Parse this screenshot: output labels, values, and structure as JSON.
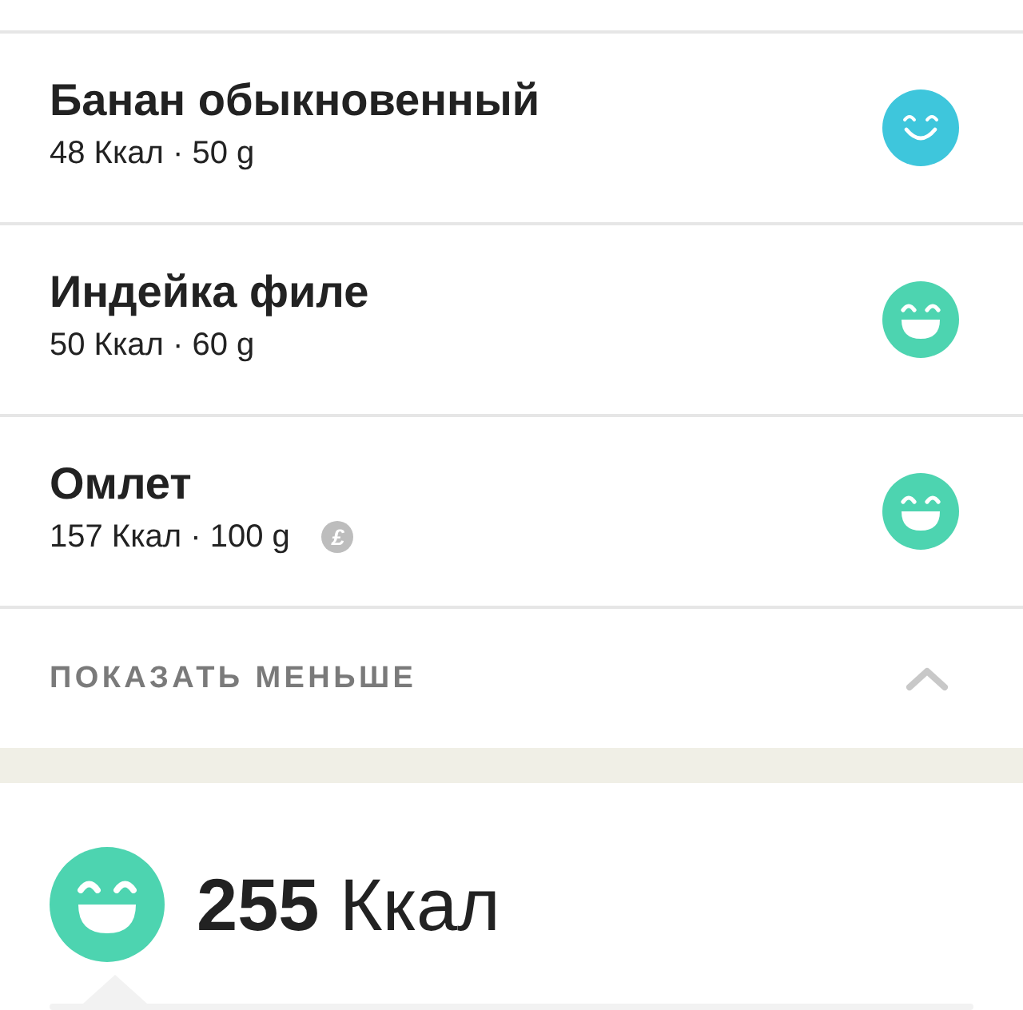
{
  "foods": [
    {
      "name": "Банан обыкновенный",
      "details": "48 Ккал · 50 g",
      "kind": "smile",
      "color": "#3ec6dc"
    },
    {
      "name": "Индейка филе",
      "details": "50 Ккал · 60 g",
      "kind": "laugh",
      "color": "#4dd4b0"
    },
    {
      "name": "Омлет",
      "details": "157 Ккал · 100 g",
      "badge": "£",
      "kind": "laugh",
      "color": "#4dd4b0"
    }
  ],
  "toggle": {
    "label": "ПОКАЗАТЬ МЕНЬШЕ",
    "expanded": true
  },
  "summary": {
    "value": "255",
    "unit": "Ккал",
    "kind": "laugh",
    "color": "#4dd4b0"
  }
}
